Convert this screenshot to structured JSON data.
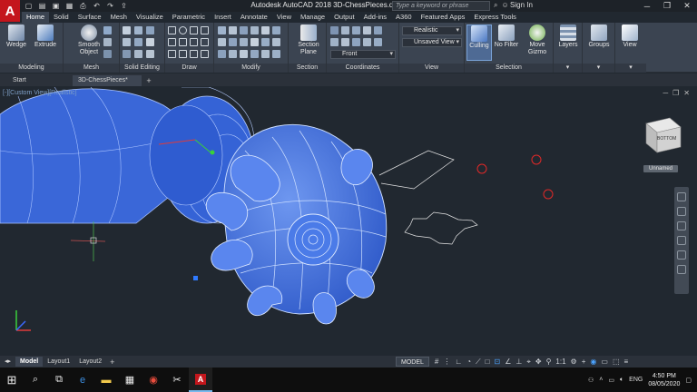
{
  "window": {
    "app_logo": "A",
    "title": "Autodesk AutoCAD 2018    3D-ChessPieces.dwg",
    "search_placeholder": "Type a keyword or phrase",
    "sign_in": "Sign In"
  },
  "ribbon_tabs": [
    "Home",
    "Solid",
    "Surface",
    "Mesh",
    "Visualize",
    "Parametric",
    "Insert",
    "Annotate",
    "View",
    "Manage",
    "Output",
    "Add-ins",
    "A360",
    "Featured Apps",
    "Express Tools"
  ],
  "ribbon": {
    "modeling": {
      "label": "Modeling",
      "wedge": "Wedge",
      "extrude": "Extrude"
    },
    "mesh": {
      "label": "Mesh",
      "smooth_object": "Smooth Object"
    },
    "solid_editing": {
      "label": "Solid Editing"
    },
    "draw": {
      "label": "Draw"
    },
    "modify": {
      "label": "Modify"
    },
    "section": {
      "label": "Section",
      "section_plane": "Section Plane"
    },
    "coordinates": {
      "label": "Coordinates",
      "ucs_dropdown": "Front"
    },
    "view": {
      "label": "View",
      "visual_style": "Realistic",
      "saved_view": "Unsaved View"
    },
    "selection": {
      "label": "Selection",
      "culling": "Culling",
      "no_filter": "No Filter",
      "move_gizmo": "Move Gizmo"
    },
    "layers": {
      "label": "Layers"
    },
    "groups": {
      "label": "Groups"
    },
    "view_panel": {
      "label": "View"
    }
  },
  "file_tabs": {
    "start": "Start",
    "drawing": "3D-ChessPieces*",
    "close": "×",
    "plus": "+"
  },
  "viewport": {
    "label": "[-][Custom View][Realistic]",
    "viewcube_face": "BOTTOM",
    "view_name": "Unnamed"
  },
  "layout_tabs": {
    "model": "Model",
    "layout1": "Layout1",
    "layout2": "Layout2",
    "plus": "+"
  },
  "status_bar": {
    "model_space": "MODEL",
    "scale": "1:1"
  },
  "taskbar": {
    "language": "ENG",
    "time": "4:50 PM",
    "date": "08/05/2020"
  },
  "colors": {
    "accent": "#4b8cff",
    "brand_red": "#c4161c",
    "model_blue": "#3d6ed8"
  }
}
